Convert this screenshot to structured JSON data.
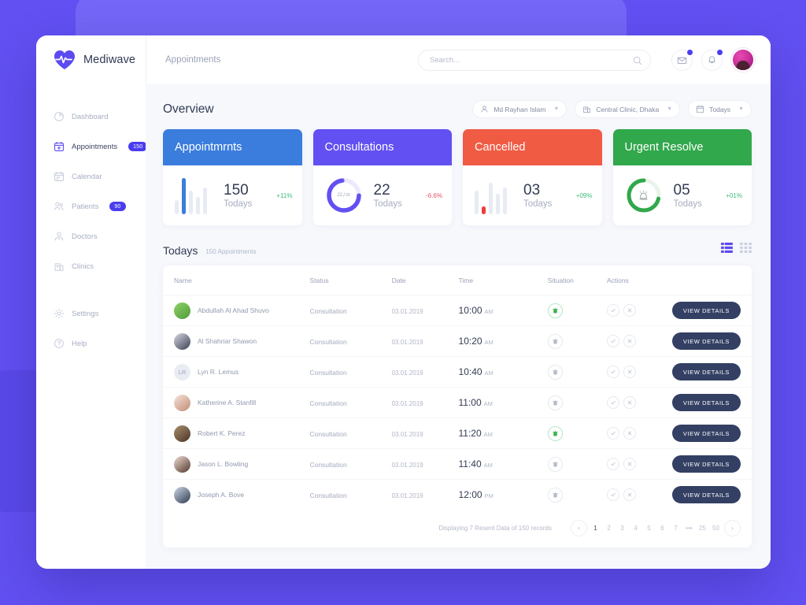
{
  "brand": {
    "name": "Mediwave",
    "logo_icon": "heart-pulse-icon",
    "accent": "#5b4bf0"
  },
  "topbar": {
    "page_tab": "Appointments",
    "search": {
      "placeholder": "Search...",
      "value": "",
      "icon": "search-icon"
    },
    "mail_icon": "mail-icon",
    "bell_icon": "bell-icon",
    "avatar_icon": "user-avatar"
  },
  "sidebar": {
    "items": [
      {
        "label": "Dashboard",
        "icon": "dashboard-icon",
        "badge": "",
        "active": false
      },
      {
        "label": "Appointments",
        "icon": "calendar-plus-icon",
        "badge": "150",
        "active": true
      },
      {
        "label": "Calendar",
        "icon": "calendar-icon",
        "badge": "",
        "active": false
      },
      {
        "label": "Patients",
        "icon": "patients-icon",
        "badge": "90",
        "active": false
      },
      {
        "label": "Doctors",
        "icon": "doctor-icon",
        "badge": "",
        "active": false
      },
      {
        "label": "Clinics",
        "icon": "clinic-icon",
        "badge": "",
        "active": false
      }
    ],
    "footer_items": [
      {
        "label": "Settings",
        "icon": "gear-icon"
      },
      {
        "label": "Help",
        "icon": "help-icon"
      }
    ]
  },
  "overview": {
    "title": "Overview",
    "filters": [
      {
        "label": "Md Rayhan Islam",
        "icon": "user-icon",
        "caret": "chevron-down-icon"
      },
      {
        "label": "Central Clinic, Dhaka",
        "icon": "clinic-icon",
        "caret": "chevron-down-icon"
      },
      {
        "label": "Todays",
        "icon": "calendar-icon",
        "caret": "chevron-down-icon"
      }
    ]
  },
  "chart_data": [
    {
      "type": "bar",
      "title": "Appointmrnts",
      "header_color": "#3b7ddd",
      "value": "150",
      "sublabel": "Todays",
      "delta": "+11%",
      "delta_color": "#3ebd7a",
      "categories": [
        "1",
        "2",
        "3",
        "4",
        "5"
      ],
      "values": [
        18,
        46,
        30,
        22,
        34
      ],
      "highlight_index": 1,
      "highlight_color": "#3b7ddd",
      "base_color": "#e6ebf4",
      "ylim": [
        0,
        46
      ]
    },
    {
      "type": "pie",
      "title": "Consultations",
      "header_color": "#6250f2",
      "value": "22",
      "sublabel": "Todays",
      "delta": "-6.6%",
      "delta_color": "#e8516a",
      "fraction_numerator": "22",
      "fraction_denominator": "30",
      "percent": 73,
      "arc_color": "#6250f2",
      "track_color": "#ece9fd"
    },
    {
      "type": "bar",
      "title": "Cancelled",
      "header_color": "#ef5b43",
      "value": "03",
      "sublabel": "Todays",
      "delta": "+09%",
      "delta_color": "#3ebd7a",
      "categories": [
        "1",
        "2",
        "3",
        "4",
        "5"
      ],
      "values": [
        30,
        10,
        40,
        26,
        34
      ],
      "highlight_index": 1,
      "highlight_color": "#ef3b3b",
      "base_color": "#e6ebf4",
      "ylim": [
        0,
        40
      ]
    },
    {
      "type": "pie",
      "title": "Urgent Resolve",
      "header_color": "#31a84c",
      "value": "05",
      "sublabel": "Todays",
      "delta": "+01%",
      "delta_color": "#3ebd7a",
      "percent": 72,
      "arc_color": "#31a84c",
      "track_color": "#e8f3ea",
      "center_icon": "alarm-icon"
    }
  ],
  "todays": {
    "title": "Todays",
    "subtitle": "150 Appointments",
    "list_view_icon": "list-view-icon",
    "grid_view_icon": "grid-view-icon"
  },
  "table": {
    "columns": [
      "Name",
      "Status",
      "Date",
      "Time",
      "Situation",
      "Actions"
    ],
    "rows": [
      {
        "name": "Abdullah Al Ahad Shuvo",
        "initials": "",
        "status": "Consultation",
        "date": "03.01.2019",
        "time": "10:00",
        "meridiem": "AM",
        "situation": "urgent",
        "button": "VIEW DETAILS"
      },
      {
        "name": "Al Shahriar Shawon",
        "initials": "",
        "status": "Consultation",
        "date": "03.01.2019",
        "time": "10:20",
        "meridiem": "AM",
        "situation": "normal",
        "button": "VIEW DETAILS"
      },
      {
        "name": "Lyn R. Lemus",
        "initials": "LR",
        "status": "Consultation",
        "date": "03.01.2019",
        "time": "10:40",
        "meridiem": "AM",
        "situation": "normal",
        "button": "VIEW DETAILS"
      },
      {
        "name": "Katherine A. Stanfill",
        "initials": "",
        "status": "Consultation",
        "date": "03.01.2019",
        "time": "11:00",
        "meridiem": "AM",
        "situation": "normal",
        "button": "VIEW DETAILS"
      },
      {
        "name": "Robert K. Perez",
        "initials": "",
        "status": "Consultation",
        "date": "03.01.2019",
        "time": "11:20",
        "meridiem": "AM",
        "situation": "urgent",
        "button": "VIEW DETAILS"
      },
      {
        "name": "Jason L. Bowling",
        "initials": "",
        "status": "Consultation",
        "date": "03.01.2019",
        "time": "11:40",
        "meridiem": "AM",
        "situation": "normal",
        "button": "VIEW DETAILS"
      },
      {
        "name": "Joseph A. Bove",
        "initials": "",
        "status": "Consultation",
        "date": "03.01.2019",
        "time": "12:00",
        "meridiem": "PM",
        "situation": "normal",
        "button": "VIEW DETAILS"
      }
    ],
    "approve_icon": "check-circle-icon",
    "reject_icon": "x-circle-icon"
  },
  "pagination": {
    "info": "Displaying 7  Resent Data of 150 records",
    "prev_icon": "chevron-left-icon",
    "next_icon": "chevron-right-icon",
    "pages": [
      "1",
      "2",
      "3",
      "4",
      "5",
      "6",
      "7",
      "•••",
      "25",
      "50"
    ],
    "active_page": "1"
  }
}
